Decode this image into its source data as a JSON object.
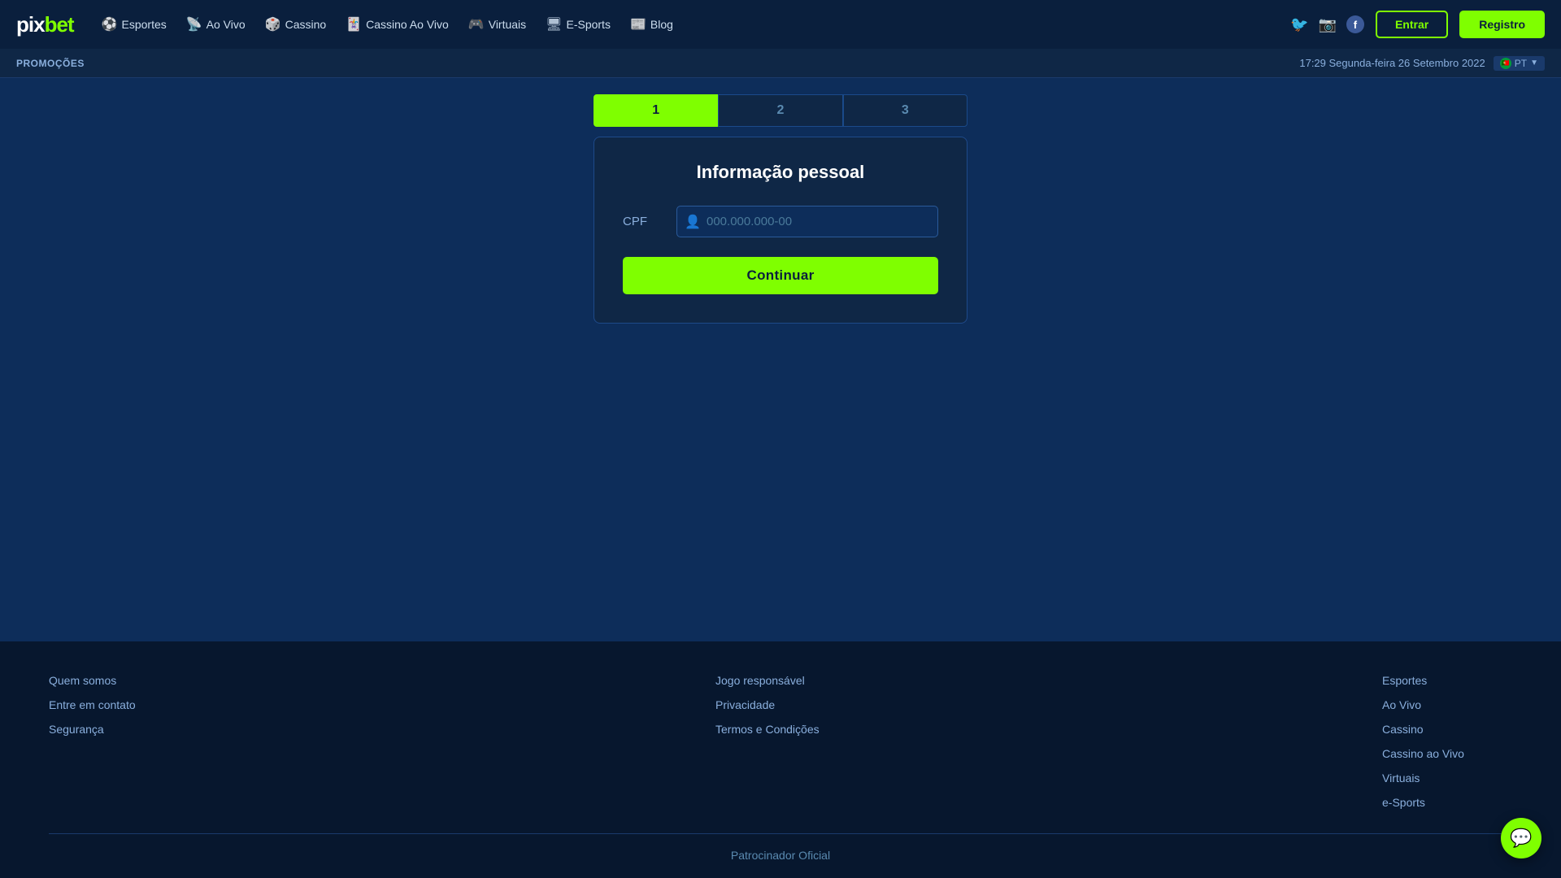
{
  "brand": {
    "name_pix": "pix",
    "name_bet": "bet",
    "logo_label": "pixbet logo"
  },
  "nav": {
    "items": [
      {
        "id": "esportes",
        "label": "Esportes",
        "icon": "⚽"
      },
      {
        "id": "ao-vivo",
        "label": "Ao Vivo",
        "icon": "📡"
      },
      {
        "id": "cassino",
        "label": "Cassino",
        "icon": "🎲"
      },
      {
        "id": "cassino-ao-vivo",
        "label": "Cassino Ao Vivo",
        "icon": "🃏"
      },
      {
        "id": "virtuais",
        "label": "Virtuais",
        "icon": "🎮"
      },
      {
        "id": "e-sports",
        "label": "E-Sports",
        "icon": "🖥"
      },
      {
        "id": "blog",
        "label": "Blog",
        "icon": "📰"
      }
    ]
  },
  "header": {
    "login_btn": "Entrar",
    "register_btn": "Registro"
  },
  "promo_bar": {
    "label": "PROMOÇÕES",
    "datetime": "17:29 Segunda-feira 26 Setembro 2022",
    "lang": "PT"
  },
  "steps": [
    {
      "number": "1",
      "active": true
    },
    {
      "number": "2",
      "active": false
    },
    {
      "number": "3",
      "active": false
    }
  ],
  "form": {
    "title": "Informação pessoal",
    "cpf_label": "CPF",
    "cpf_placeholder": "000.000.000-00",
    "submit_btn": "Continuar"
  },
  "footer": {
    "col1": {
      "items": [
        {
          "label": "Quem somos"
        },
        {
          "label": "Entre em contato"
        },
        {
          "label": "Segurança"
        }
      ]
    },
    "col2": {
      "items": [
        {
          "label": "Jogo responsável"
        },
        {
          "label": "Privacidade"
        },
        {
          "label": "Termos e Condições"
        }
      ]
    },
    "col3": {
      "items": [
        {
          "label": "Esportes"
        },
        {
          "label": "Ao Vivo"
        },
        {
          "label": "Cassino"
        },
        {
          "label": "Cassino ao Vivo"
        },
        {
          "label": "Virtuais"
        },
        {
          "label": "e-Sports"
        }
      ]
    },
    "sponsor_label": "Patrocinador Oficial"
  },
  "social": {
    "twitter_icon": "🐦",
    "instagram_icon": "📷",
    "facebook_icon": "f"
  },
  "chat": {
    "icon": "💬"
  }
}
